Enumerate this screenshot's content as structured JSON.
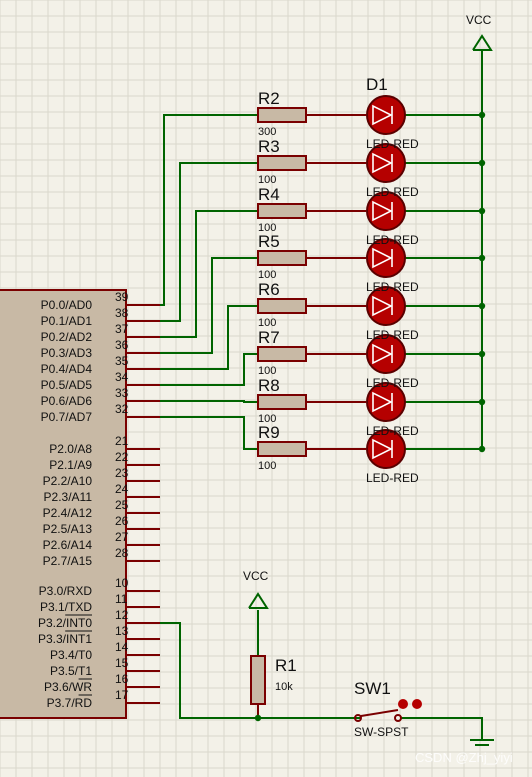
{
  "power": {
    "vcc_top": "VCC",
    "vcc_bottom": "VCC"
  },
  "leds": {
    "d1_label": "D1",
    "type_label": "LED-RED",
    "items": [
      {
        "type": "LED-RED"
      },
      {
        "type": "LED-RED"
      },
      {
        "type": "LED-RED"
      },
      {
        "type": "LED-RED"
      },
      {
        "type": "LED-RED"
      },
      {
        "type": "LED-RED"
      },
      {
        "type": "LED-RED"
      },
      {
        "type": "LED-RED"
      }
    ]
  },
  "resistors": [
    {
      "ref": "R2",
      "value": "300"
    },
    {
      "ref": "R3",
      "value": "100"
    },
    {
      "ref": "R4",
      "value": "100"
    },
    {
      "ref": "R5",
      "value": "100"
    },
    {
      "ref": "R6",
      "value": "100"
    },
    {
      "ref": "R7",
      "value": "100"
    },
    {
      "ref": "R8",
      "value": "100"
    },
    {
      "ref": "R9",
      "value": "100"
    }
  ],
  "mcu": {
    "port0": [
      {
        "name": "P0.0/AD0",
        "pin": "39"
      },
      {
        "name": "P0.1/AD1",
        "pin": "38"
      },
      {
        "name": "P0.2/AD2",
        "pin": "37"
      },
      {
        "name": "P0.3/AD3",
        "pin": "36"
      },
      {
        "name": "P0.4/AD4",
        "pin": "35"
      },
      {
        "name": "P0.5/AD5",
        "pin": "34"
      },
      {
        "name": "P0.6/AD6",
        "pin": "33"
      },
      {
        "name": "P0.7/AD7",
        "pin": "32"
      }
    ],
    "port2": [
      {
        "name": "P2.0/A8",
        "pin": "21"
      },
      {
        "name": "P2.1/A9",
        "pin": "22"
      },
      {
        "name": "P2.2/A10",
        "pin": "23"
      },
      {
        "name": "P2.3/A11",
        "pin": "24"
      },
      {
        "name": "P2.4/A12",
        "pin": "25"
      },
      {
        "name": "P2.5/A13",
        "pin": "26"
      },
      {
        "name": "P2.6/A14",
        "pin": "27"
      },
      {
        "name": "P2.7/A15",
        "pin": "28"
      }
    ],
    "port3": [
      {
        "name": "P3.0/RXD",
        "pin": "10"
      },
      {
        "name": "P3.1/TXD",
        "pin": "11"
      },
      {
        "name": "P3.2/INT0",
        "pin": "12"
      },
      {
        "name": "P3.3/INT1",
        "pin": "13"
      },
      {
        "name": "P3.4/T0",
        "pin": "14"
      },
      {
        "name": "P3.5/T1",
        "pin": "15"
      },
      {
        "name": "P3.6/WR",
        "pin": "16"
      },
      {
        "name": "P3.7/RD",
        "pin": "17"
      }
    ]
  },
  "r1": {
    "ref": "R1",
    "value": "10k"
  },
  "sw1": {
    "ref": "SW1",
    "type": "SW-SPST"
  },
  "watermark": "CSDN @Zhj_yiyi",
  "colors": {
    "wire": "#006400",
    "body": "#7a0000",
    "fill": "#c8b9a5",
    "led": "#b50000",
    "grid": "#d9d7cc",
    "background": "#f3f1e8"
  }
}
